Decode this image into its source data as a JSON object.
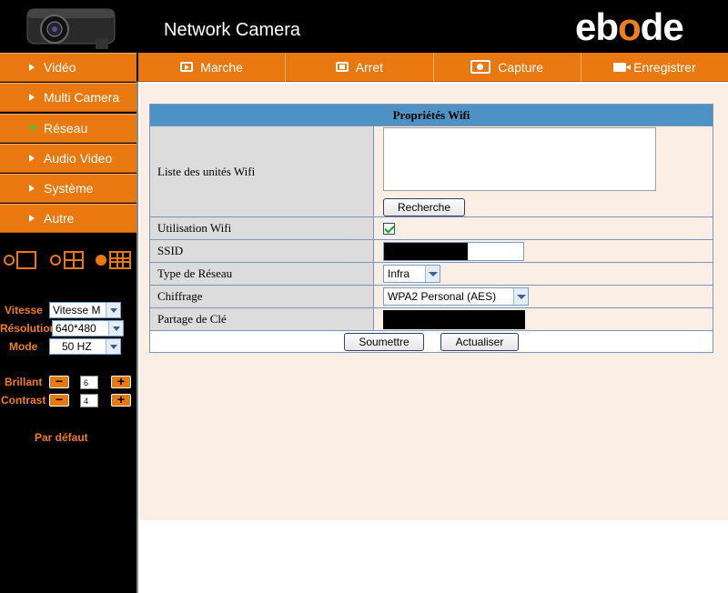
{
  "header": {
    "title": "Network Camera",
    "brand_e": "eb",
    "brand_o": "o",
    "brand_de": "de"
  },
  "topnav": [
    {
      "label": "Marche",
      "icon": "play-icon"
    },
    {
      "label": "Arret",
      "icon": "stop-icon"
    },
    {
      "label": "Capture",
      "icon": "camera-icon"
    },
    {
      "label": "Enregistrer",
      "icon": "video-camera-icon"
    }
  ],
  "sidebar": {
    "items": [
      {
        "label": "Vidéo"
      },
      {
        "label": "Multi Camera"
      },
      {
        "label": "Réseau",
        "expanded": true
      },
      {
        "label": "Audio Video"
      },
      {
        "label": "Système"
      },
      {
        "label": "Autre"
      }
    ],
    "layout_selected": "9-grid",
    "vitesse_label": "Vitesse",
    "vitesse_value": "Vitesse M",
    "resolution_label": "Résolution",
    "resolution_value": "640*480",
    "mode_label": "Mode",
    "mode_value": "50 HZ",
    "brillant_label": "Brillant",
    "brillant_value": "6",
    "contrast_label": "Contrast",
    "contrast_value": "4",
    "default_label": "Par défaut"
  },
  "wifi": {
    "title": "Propriétés Wifi",
    "list_label": "Liste des unités Wifi",
    "search_button": "Recherche",
    "usage_label": "Utilisation Wifi",
    "usage_checked": true,
    "ssid_label": "SSID",
    "network_type_label": "Type de Réseau",
    "network_type_value": "Infra",
    "encryption_label": "Chiffrage",
    "encryption_value": "WPA2 Personal (AES)",
    "key_label": "Partage de Clé",
    "submit_button": "Soumettre",
    "refresh_button": "Actualiser"
  },
  "colors": {
    "accent": "#e8780f",
    "header_bar": "#4f93c6",
    "panel_bg": "#fbeee4"
  }
}
